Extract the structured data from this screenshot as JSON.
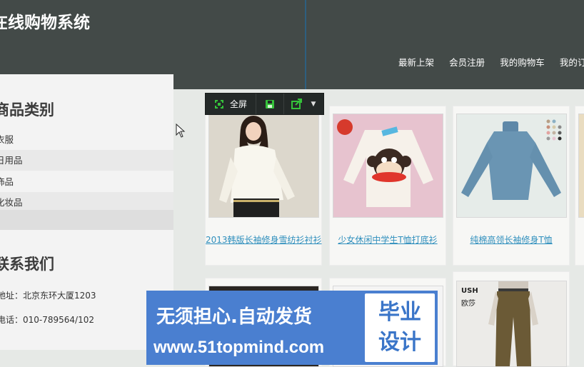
{
  "header": {
    "site_title": "在线购物系统",
    "nav": [
      "最新上架",
      "会员注册",
      "我的购物车",
      "我的订"
    ]
  },
  "sidebar": {
    "categories_title": "商品类别",
    "categories": [
      "衣服",
      "日用品",
      "饰品",
      "化妆品"
    ],
    "contact_title": "联系我们",
    "address": "地址：北京东环大厦1203",
    "phone": "电话：010-789564/102"
  },
  "toolbar": {
    "fullscreen_label": "全屏",
    "icons": [
      "fullscreen-icon",
      "save-icon",
      "share-icon",
      "caret-down-icon"
    ]
  },
  "products": [
    {
      "name": "2013韩版长袖修身雪纺衫衬衫",
      "image": "white-blouse"
    },
    {
      "name": "少女休闲中学生T恤打底衫",
      "image": "pink-monkey-tee"
    },
    {
      "name": "纯棉高领长袖修身T恤",
      "image": "blue-turtleneck"
    }
  ],
  "banner": {
    "line1": "无须担心.自动发货",
    "url": "www.51topmind.com",
    "badge": [
      "毕业",
      "设计"
    ]
  },
  "product_row2_text": [
    "USH",
    "欧莎"
  ],
  "colors": {
    "header_bg": "#434a48",
    "link": "#2f8fbd",
    "banner_bg": "#4a7fd0",
    "toolbar_bg": "#242928",
    "icon_green": "#35c23a"
  }
}
